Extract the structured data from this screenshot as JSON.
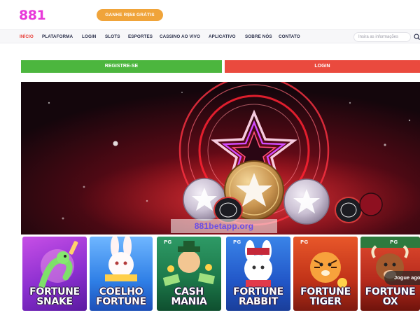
{
  "header": {
    "logo": "881",
    "promo_label": "GANHE R$58 GRÁTIS"
  },
  "nav": {
    "items": [
      {
        "label": "INÍCIO",
        "active": true
      },
      {
        "label": "PLATAFORMA"
      },
      {
        "label": "LOGIN"
      },
      {
        "label": "SLOTS"
      },
      {
        "label": "ESPORTES"
      },
      {
        "label": "CASSINO AO VIVO"
      },
      {
        "label": "APLICATIVO"
      },
      {
        "label": "SOBRE NÓS"
      },
      {
        "label": "CONTATO"
      }
    ],
    "search_placeholder": "Insira as informações"
  },
  "actions": {
    "register_label": "REGISTRE-SE",
    "login_label": "LOGIN"
  },
  "banner": {
    "watermark": "881betapp.org"
  },
  "games": [
    {
      "title_line1": "FORTUNE",
      "title_line2": "SNAKE",
      "pg": ""
    },
    {
      "title_line1": "COELHO",
      "title_line2": "FORTUNE",
      "pg": ""
    },
    {
      "title_line1": "CASH",
      "title_line2": "MANIA",
      "pg": "PG"
    },
    {
      "title_line1": "FORTUNE",
      "title_line2": "RABBIT",
      "pg": "PG"
    },
    {
      "title_line1": "FORTUNE",
      "title_line2": "TIGER",
      "pg": "PG"
    },
    {
      "title_line1": "FORTUNE",
      "title_line2": "OX",
      "pg": "PG"
    }
  ],
  "play_label": "Jogue agora",
  "colors": {
    "brand": "#e838d9",
    "promo": "#f0a43a",
    "register": "#4cb63e",
    "login": "#ea4a3e",
    "nav_active": "#e8403a"
  }
}
